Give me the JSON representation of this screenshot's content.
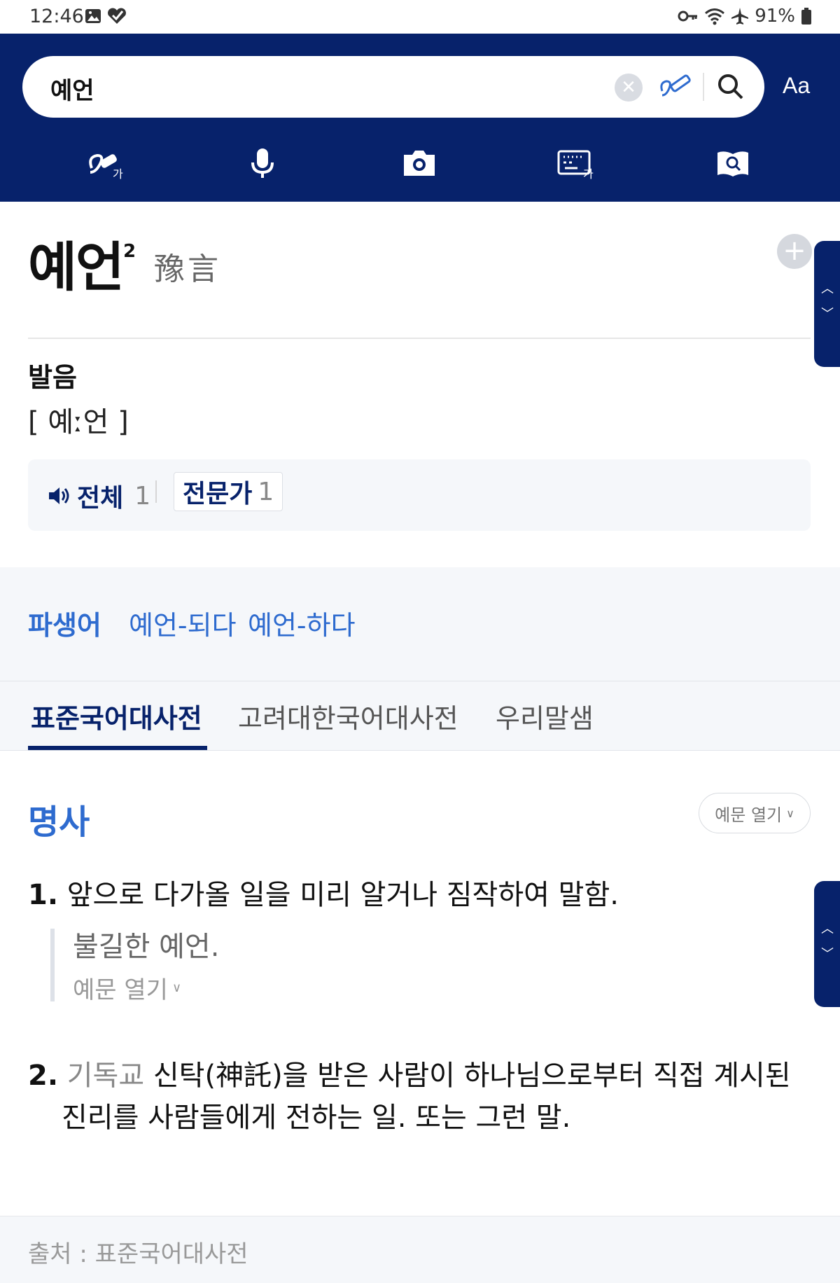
{
  "status_bar": {
    "time": "12:46",
    "battery": "91%",
    "icons_left": [
      "image-icon",
      "heart-check-icon"
    ],
    "icons_right": [
      "vpn-key-icon",
      "wifi-icon",
      "airplane-icon",
      "battery-icon"
    ]
  },
  "search": {
    "value": "예언",
    "font_button": "Aa"
  },
  "toolbar": {
    "items": [
      "handwriting-icon",
      "microphone-icon",
      "camera-icon",
      "keyboard-icon",
      "book-search-icon"
    ]
  },
  "entry": {
    "headword": "예언",
    "superscript": "2",
    "hanja": "豫言"
  },
  "pronunciation": {
    "title": "발음",
    "text": "[ 예ː언 ]",
    "all_label": "전체",
    "all_count": "1",
    "expert_label": "전문가",
    "expert_count": "1"
  },
  "derivatives": {
    "label": "파생어",
    "links": [
      "예언-되다",
      "예언-하다"
    ]
  },
  "tabs": [
    {
      "label": "표준국어대사전",
      "active": true
    },
    {
      "label": "고려대한국어대사전",
      "active": false
    },
    {
      "label": "우리말샘",
      "active": false
    }
  ],
  "meaning": {
    "pos": "명사",
    "example_toggle": "예문 열기",
    "definitions": [
      {
        "num": "1.",
        "text": "앞으로 다가올 일을 미리 알거나 짐작하여 말함.",
        "example": "불길한 예언.",
        "example_toggle": "예문 열기"
      },
      {
        "num": "2.",
        "category": "기독교",
        "text_line1": "신탁(神託)을 받은 사람이 하나님으로부터 직접 계시된",
        "text_line2": "진리를 사람들에게 전하는 일. 또는 그런 말."
      }
    ]
  },
  "footer": {
    "source": "출처 : 표준국어대사전"
  },
  "colors": {
    "header_bg": "#07226b",
    "link_blue": "#2e6bcf",
    "panel_bg": "#f5f7fa"
  }
}
